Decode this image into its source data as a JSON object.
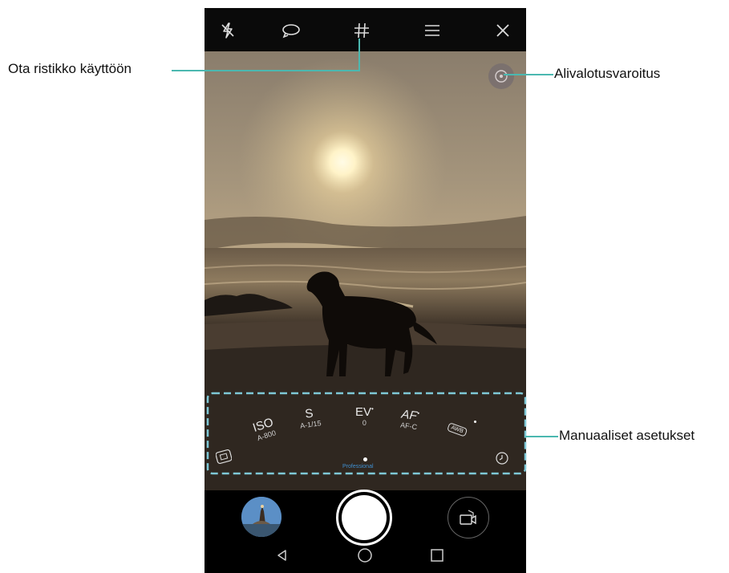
{
  "annotations": {
    "grid_label": "Ota ristikko käyttöön",
    "underexposure_label": "Alivalotusvaroitus",
    "manual_label": "Manuaaliset asetukset"
  },
  "topbar": {
    "icons": [
      "flash-off-icon",
      "hdr-loop-icon",
      "grid-icon",
      "menu-icon",
      "close-icon"
    ]
  },
  "manual_settings": {
    "iso": {
      "label": "ISO",
      "value": "A-800"
    },
    "shutter": {
      "label": "S",
      "value": "A-1/15"
    },
    "ev": {
      "label": "EV",
      "value": "0"
    },
    "af": {
      "label": "AF",
      "value": "AF-C"
    },
    "awb": {
      "label": "AWB"
    },
    "mode_label": "Professional"
  },
  "navigation": [
    "back-icon",
    "home-icon",
    "recents-icon"
  ],
  "colors": {
    "accent": "#3f8fd0",
    "callout_line": "#4bb8b0",
    "dashed_box": "#7ec8d6"
  }
}
